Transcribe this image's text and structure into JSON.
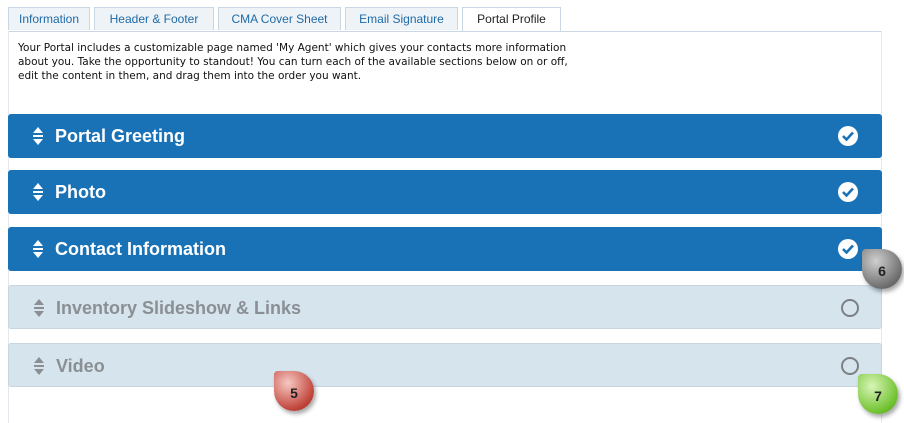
{
  "tabs": [
    "Information",
    "Header & Footer",
    "CMA Cover Sheet",
    "Email Signature",
    "Portal Profile"
  ],
  "active_tab": "Portal Profile",
  "intro": [
    "Your Portal includes a customizable page named 'My Agent' which gives your contacts more information",
    "about you. Take the opportunity to standout! You can turn each of the available sections below on or off,",
    "edit the content in them, and drag them into the order you want."
  ],
  "sections": [
    {
      "title": "Portal Greeting",
      "enabled": true
    },
    {
      "title": "Photo",
      "enabled": true
    },
    {
      "title": "Contact Information",
      "enabled": true
    },
    {
      "title": "Inventory Slideshow & Links",
      "enabled": false
    },
    {
      "title": "Video",
      "enabled": false
    }
  ],
  "callouts": {
    "c6": "6",
    "c5": "5",
    "c7": "7"
  },
  "colors": {
    "enabled": "#1a72b6",
    "disabled": "#d6e4ee"
  }
}
